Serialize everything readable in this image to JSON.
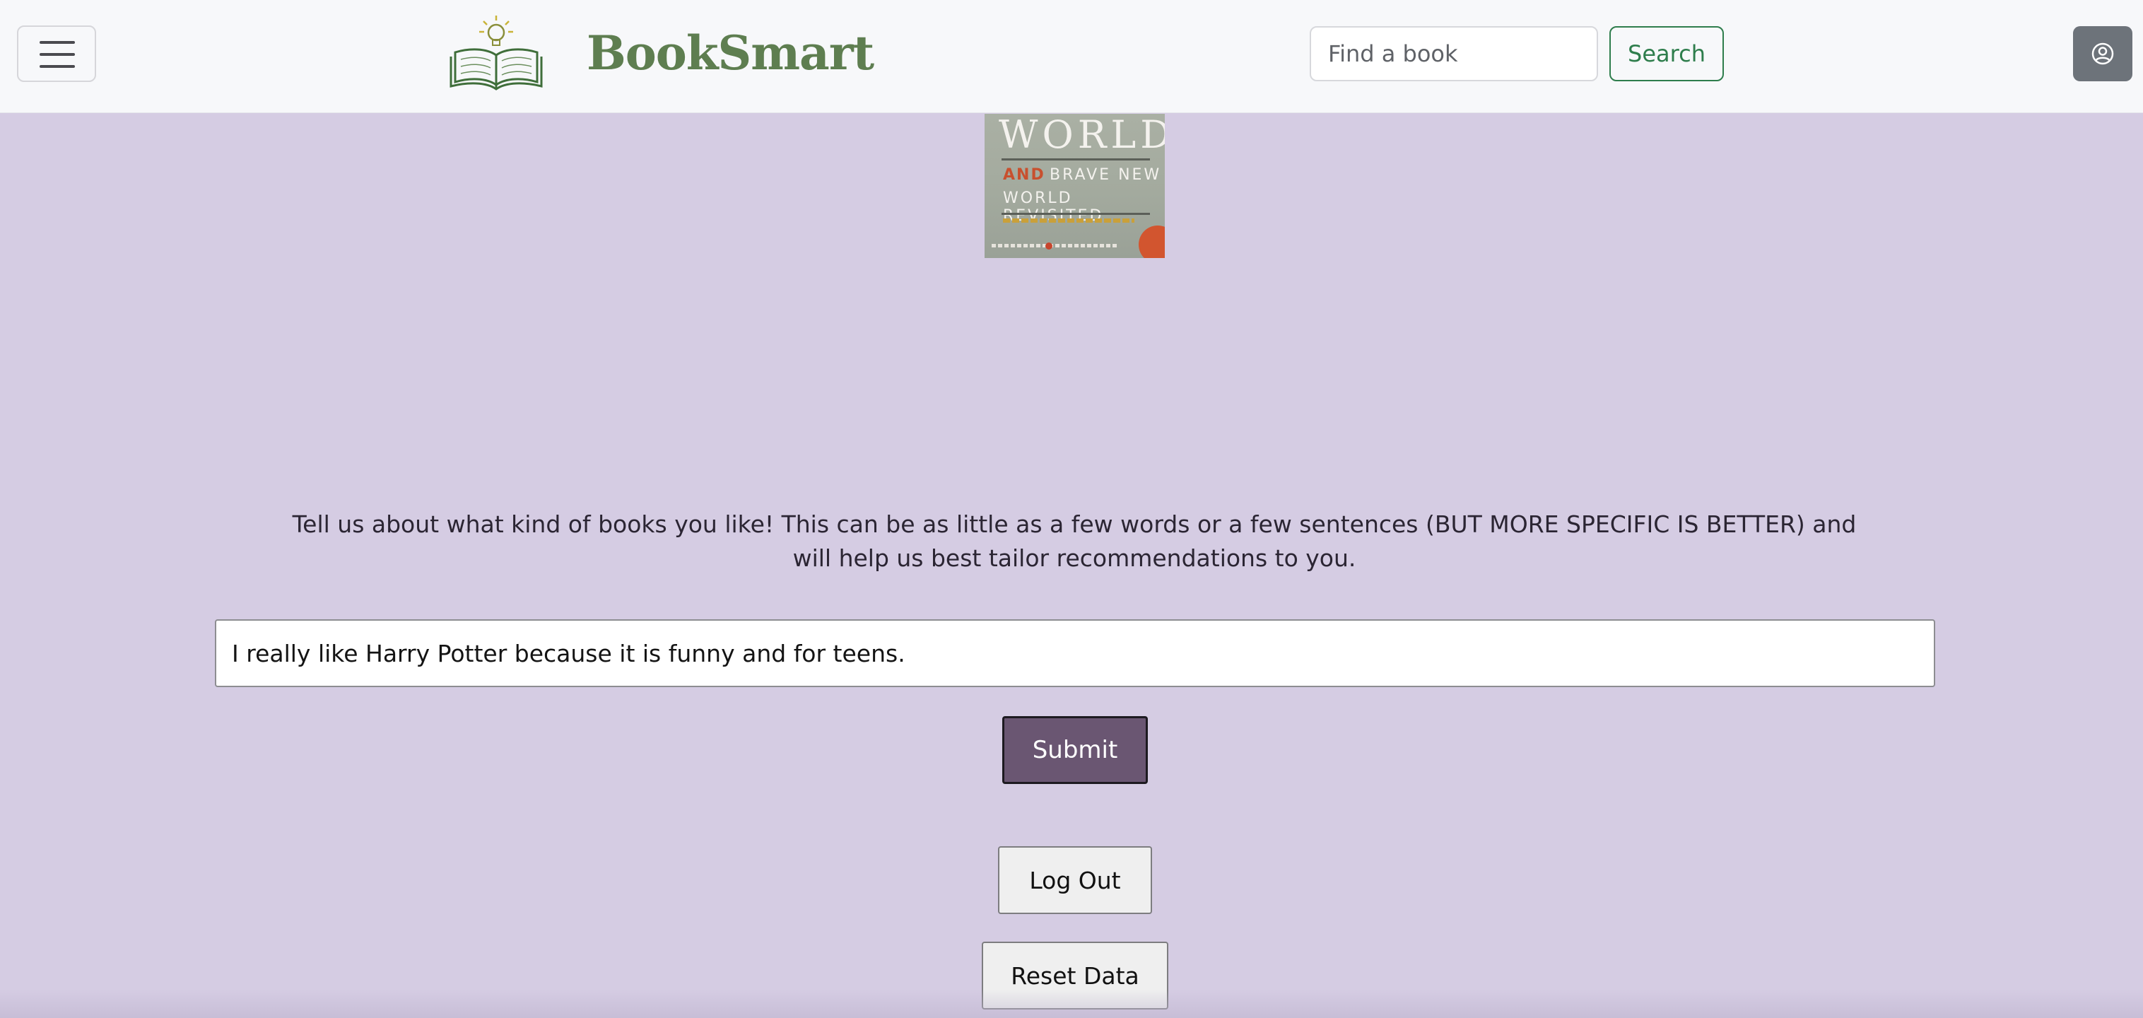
{
  "navbar": {
    "brand": "BookSmart",
    "search": {
      "placeholder": "Find a book",
      "button_label": "Search"
    },
    "icons": {
      "menu": "hamburger-menu-icon",
      "logo": "open-book-lightbulb-logo",
      "profile": "user-circle-icon"
    }
  },
  "book_cover": {
    "title": "WORLD",
    "and": "AND",
    "subtitle_line1": "BRAVE NEW",
    "subtitle_line2": "WORLD REVISITED"
  },
  "main": {
    "prompt": "Tell us about what kind of books you like! This can be as little as a few words or a few sentences (BUT MORE SPECIFIC IS BETTER) and will help us best tailor recommendations to you.",
    "preference_input_value": "I really like Harry Potter because it is funny and for teens.",
    "submit_label": "Submit",
    "logout_label": "Log Out",
    "reset_label": "Reset Data"
  },
  "colors": {
    "page_background": "#d5cce3",
    "navbar_background": "#f7f8fa",
    "brand_green": "#5e7e50",
    "search_button_green": "#2e7d4c",
    "submit_purple": "#6a5672",
    "profile_gray": "#6d737a"
  }
}
